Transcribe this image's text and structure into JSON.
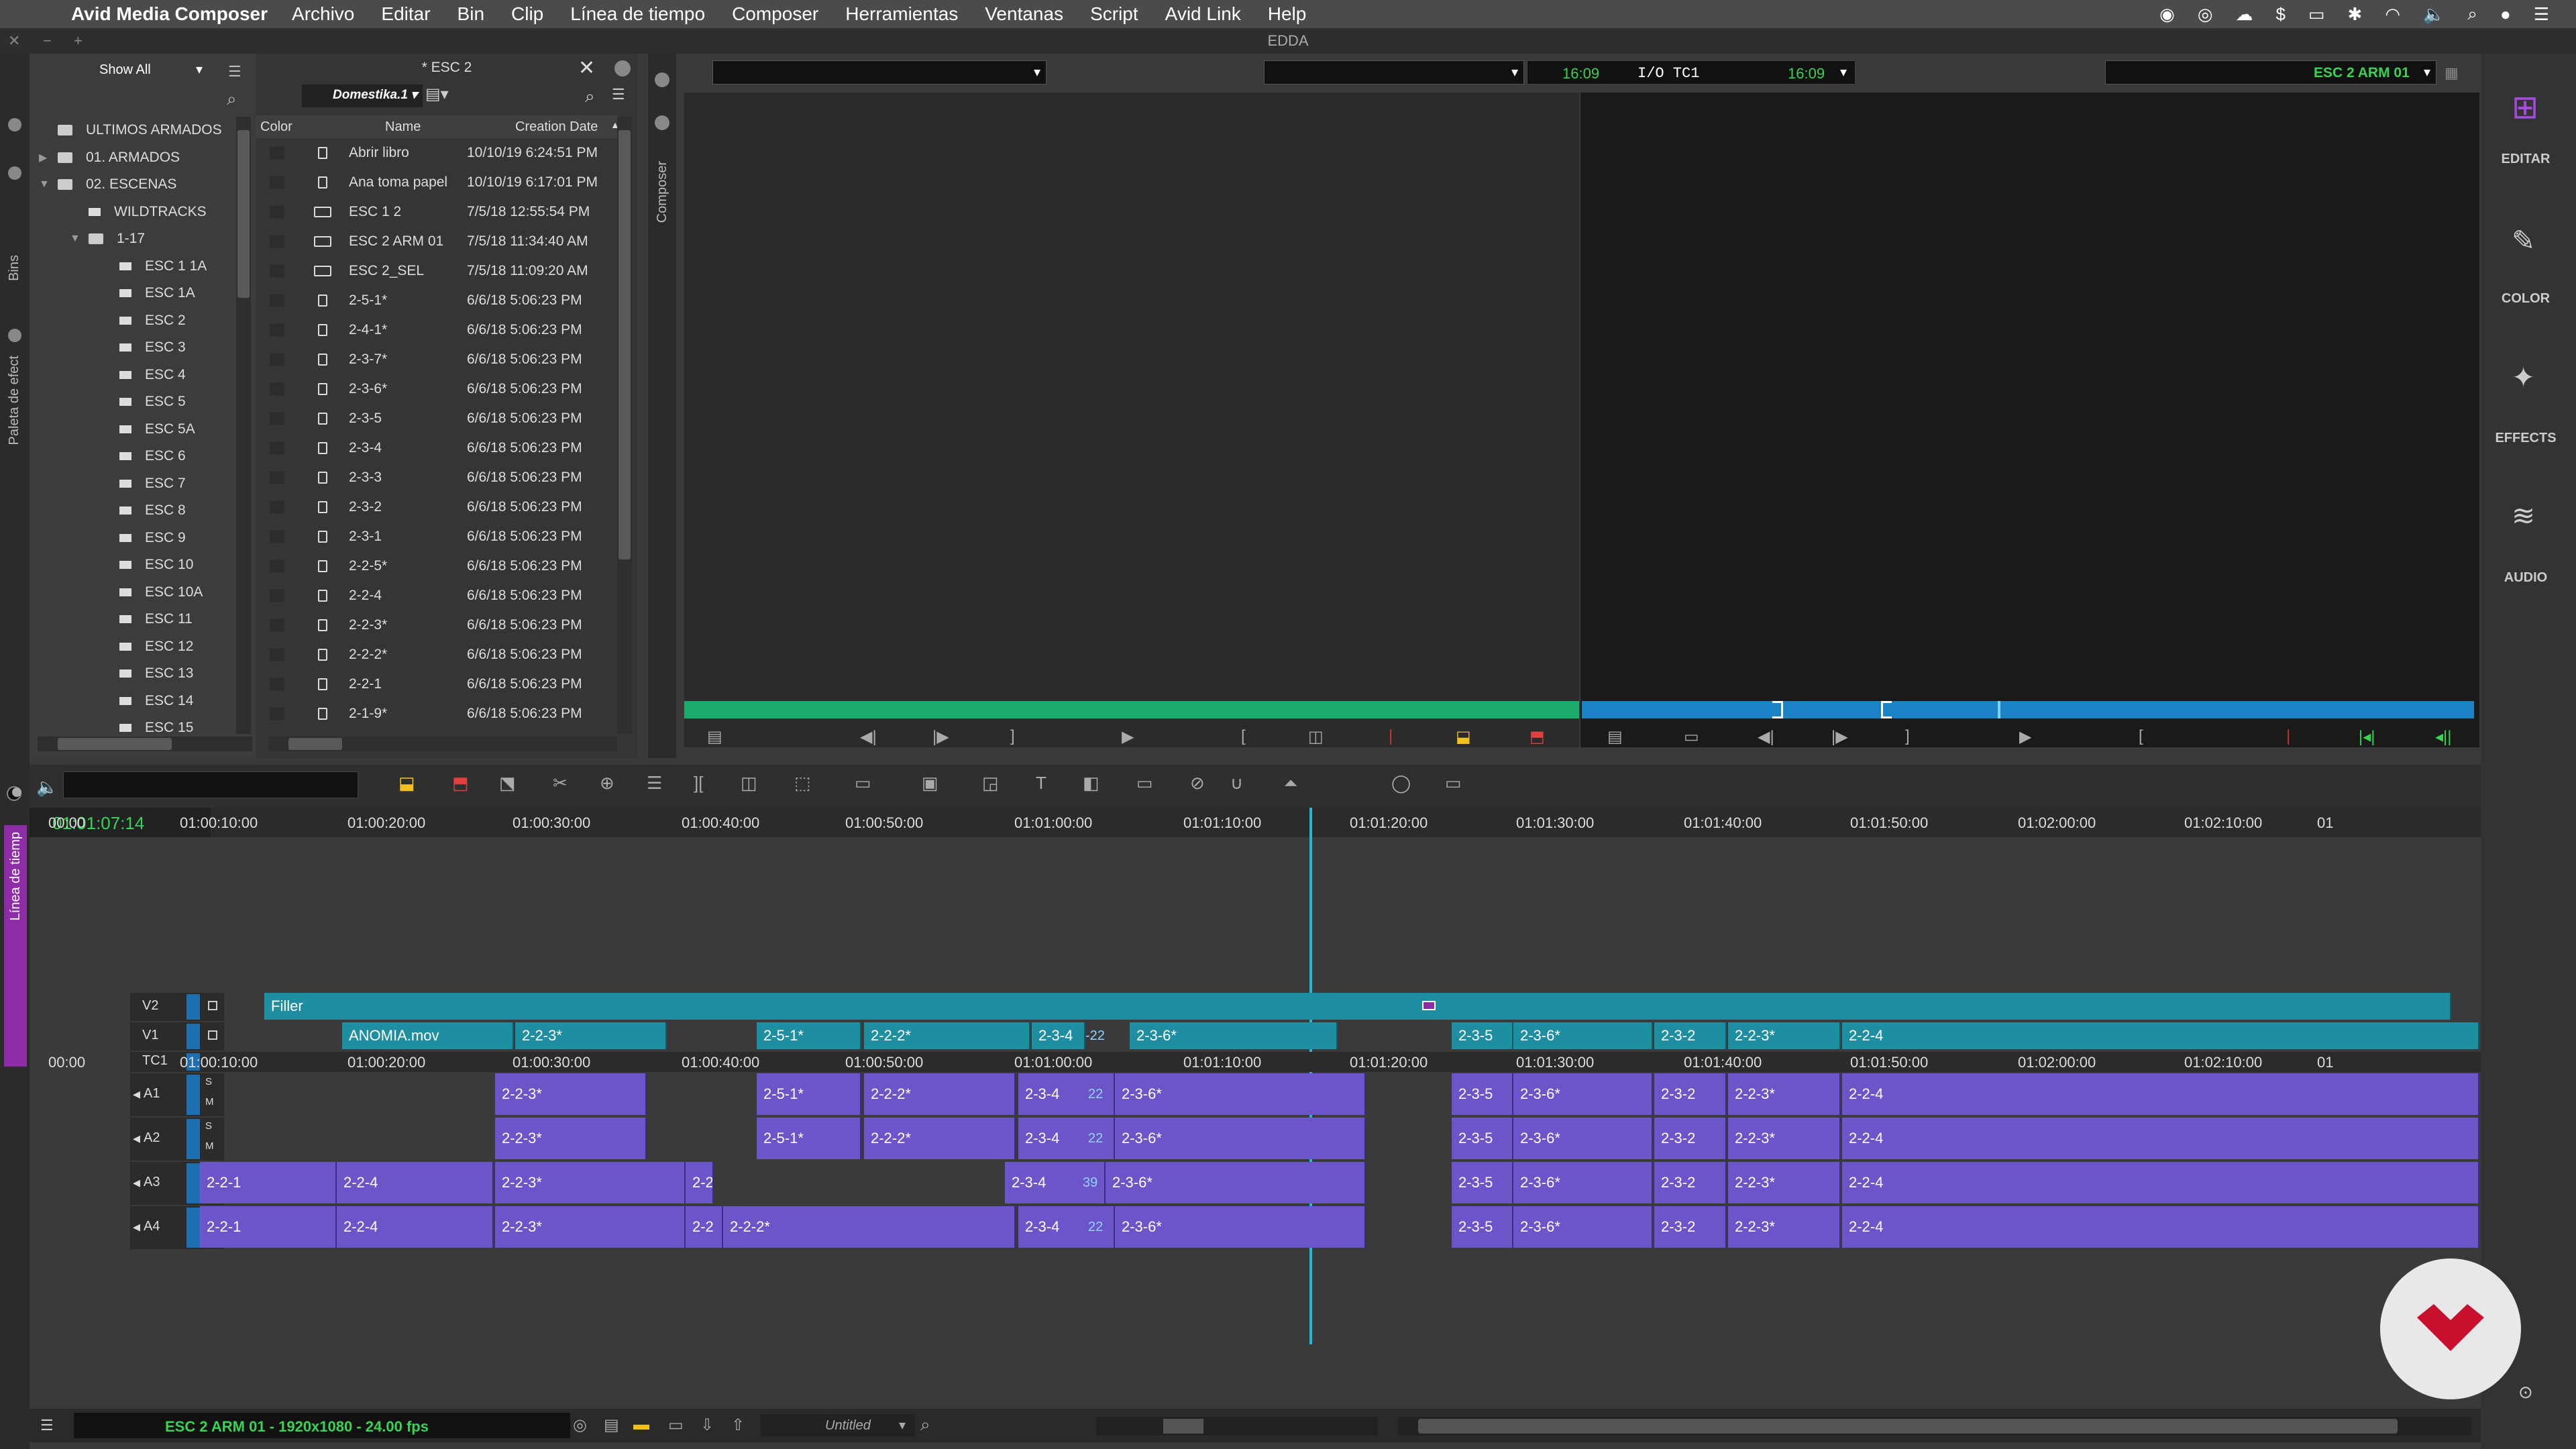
{
  "menubar": {
    "app_name": "Avid Media Composer",
    "items": [
      "Archivo",
      "Editar",
      "Bin",
      "Clip",
      "Línea de tiempo",
      "Composer",
      "Herramientas",
      "Ventanas",
      "Script",
      "Avid Link",
      "Help"
    ]
  },
  "window_title": "EDDA",
  "side_tabs": {
    "bins": "Bins",
    "effects": "Paleta de efect",
    "timeline": "Línea de tiemp",
    "composer": "Composer"
  },
  "tree": {
    "show_all": "Show All",
    "items": [
      {
        "label": "ULTIMOS ARMADOS",
        "indent": 0,
        "arrow": "",
        "folder": true
      },
      {
        "label": "01. ARMADOS",
        "indent": 0,
        "arrow": "▶",
        "folder": true
      },
      {
        "label": "02. ESCENAS",
        "indent": 0,
        "arrow": "▼",
        "folder": true
      },
      {
        "label": "WILDTRACKS",
        "indent": 1,
        "arrow": "",
        "folder": false
      },
      {
        "label": "1-17",
        "indent": 1,
        "arrow": "▼",
        "folder": true
      },
      {
        "label": "ESC 1 1A",
        "indent": 2,
        "arrow": "",
        "folder": false
      },
      {
        "label": "ESC 1A",
        "indent": 2,
        "arrow": "",
        "folder": false
      },
      {
        "label": "ESC 2",
        "indent": 2,
        "arrow": "",
        "folder": false
      },
      {
        "label": "ESC 3",
        "indent": 2,
        "arrow": "",
        "folder": false
      },
      {
        "label": "ESC 4",
        "indent": 2,
        "arrow": "",
        "folder": false
      },
      {
        "label": "ESC 5",
        "indent": 2,
        "arrow": "",
        "folder": false
      },
      {
        "label": "ESC 5A",
        "indent": 2,
        "arrow": "",
        "folder": false
      },
      {
        "label": "ESC 6",
        "indent": 2,
        "arrow": "",
        "folder": false
      },
      {
        "label": "ESC 7",
        "indent": 2,
        "arrow": "",
        "folder": false
      },
      {
        "label": "ESC 8",
        "indent": 2,
        "arrow": "",
        "folder": false
      },
      {
        "label": "ESC 9",
        "indent": 2,
        "arrow": "",
        "folder": false
      },
      {
        "label": "ESC 10",
        "indent": 2,
        "arrow": "",
        "folder": false
      },
      {
        "label": "ESC 10A",
        "indent": 2,
        "arrow": "",
        "folder": false
      },
      {
        "label": "ESC 11",
        "indent": 2,
        "arrow": "",
        "folder": false
      },
      {
        "label": "ESC 12",
        "indent": 2,
        "arrow": "",
        "folder": false
      },
      {
        "label": "ESC 13",
        "indent": 2,
        "arrow": "",
        "folder": false
      },
      {
        "label": "ESC 14",
        "indent": 2,
        "arrow": "",
        "folder": false
      },
      {
        "label": "ESC 15",
        "indent": 2,
        "arrow": "",
        "folder": false
      }
    ]
  },
  "bin": {
    "title": "* ESC 2",
    "view_name": "Domestika.1",
    "columns": [
      "Color",
      "Name",
      "Creation Date"
    ],
    "rows": [
      {
        "name": "Abrir libro",
        "date": "10/10/19 6:24:51 PM",
        "type": "clip"
      },
      {
        "name": "Ana toma papel",
        "date": "10/10/19 6:17:01 PM",
        "type": "clip"
      },
      {
        "name": "ESC 1 2",
        "date": "7/5/18 12:55:54 PM",
        "type": "seq"
      },
      {
        "name": "ESC 2 ARM 01",
        "date": "7/5/18 11:34:40 AM",
        "type": "seq"
      },
      {
        "name": "ESC 2_SEL",
        "date": "7/5/18 11:09:20 AM",
        "type": "seq"
      },
      {
        "name": "2-5-1*",
        "date": "6/6/18 5:06:23 PM",
        "type": "clip"
      },
      {
        "name": "2-4-1*",
        "date": "6/6/18 5:06:23 PM",
        "type": "clip"
      },
      {
        "name": "2-3-7*",
        "date": "6/6/18 5:06:23 PM",
        "type": "clip"
      },
      {
        "name": "2-3-6*",
        "date": "6/6/18 5:06:23 PM",
        "type": "clip"
      },
      {
        "name": "2-3-5",
        "date": "6/6/18 5:06:23 PM",
        "type": "clip"
      },
      {
        "name": "2-3-4",
        "date": "6/6/18 5:06:23 PM",
        "type": "clip"
      },
      {
        "name": "2-3-3",
        "date": "6/6/18 5:06:23 PM",
        "type": "clip"
      },
      {
        "name": "2-3-2",
        "date": "6/6/18 5:06:23 PM",
        "type": "clip"
      },
      {
        "name": "2-3-1",
        "date": "6/6/18 5:06:23 PM",
        "type": "clip"
      },
      {
        "name": "2-2-5*",
        "date": "6/6/18 5:06:23 PM",
        "type": "clip"
      },
      {
        "name": "2-2-4",
        "date": "6/6/18 5:06:23 PM",
        "type": "clip"
      },
      {
        "name": "2-2-3*",
        "date": "6/6/18 5:06:23 PM",
        "type": "clip"
      },
      {
        "name": "2-2-2*",
        "date": "6/6/18 5:06:23 PM",
        "type": "clip"
      },
      {
        "name": "2-2-1",
        "date": "6/6/18 5:06:23 PM",
        "type": "clip"
      },
      {
        "name": "2-1-9*",
        "date": "6/6/18 5:06:23 PM",
        "type": "clip"
      }
    ]
  },
  "composer": {
    "record_tc1": "16:09",
    "io_label": "I/O TC1",
    "record_tc2": "16:09",
    "sequence_name": "ESC 2 ARM 01"
  },
  "right_toolbar": [
    "EDITAR",
    "COLOR",
    "EFFECTS",
    "AUDIO"
  ],
  "timeline": {
    "timecode": "01:01:07:14",
    "ruler": [
      "00:00",
      "01:00:10:00",
      "01:00:20:00",
      "01:00:30:00",
      "01:00:40:00",
      "01:00:50:00",
      "01:01:00:00",
      "01:01:10:00",
      "01:01:20:00",
      "01:01:30:00",
      "01:01:40:00",
      "01:01:50:00",
      "01:02:00:00",
      "01:02:10:00",
      "01"
    ],
    "tc1_ruler": [
      "00:00",
      "01:00:10:00",
      "01:00:20:00",
      "01:00:30:00",
      "01:00:40:00",
      "01:00:50:00",
      "01:01:00:00",
      "01:01:10:00",
      "01:01:20:00",
      "01:01:30:00",
      "01:01:40:00",
      "01:01:50:00",
      "01:02:00:00",
      "01:02:10:00",
      "01"
    ],
    "tracks": [
      "V2",
      "V1",
      "TC1",
      "A1",
      "A2",
      "A3",
      "A4"
    ],
    "filler_label": "Filler",
    "v1_clips": [
      "ANOMIA.mov",
      "2-2-3*",
      "2-5-1*",
      "2-2-2*",
      "2-3-4",
      "-22",
      "2-3-6*",
      "2-3-5",
      "2-3-6*",
      "2-3-2",
      "2-2-3*",
      "2-2-4"
    ],
    "a1_clips": [
      "2-2-3*",
      "2-5-1*",
      "2-2-2*",
      "2-3-4",
      "22",
      "2-3-6*",
      "2-3-5",
      "2-3-6*",
      "2-3-2",
      "2-2-3*",
      "2-2-4"
    ],
    "a2_clips": [
      "2-2-3*",
      "2-5-1*",
      "2-2-2*",
      "2-3-4",
      "22",
      "2-3-6*",
      "2-3-5",
      "2-3-6*",
      "2-3-2",
      "2-2-3*",
      "2-2-4"
    ],
    "a3_clips": [
      "2-2-1",
      "2-2-4",
      "2-2-3*",
      "2-2",
      "2-3-4",
      "39",
      "2-3-6*",
      "2-3-5",
      "2-3-6*",
      "2-3-2",
      "2-2-3*",
      "2-2-4"
    ],
    "a4_clips": [
      "2-2-1",
      "2-2-4",
      "2-2-3*",
      "2-2",
      "2-2-2*",
      "2-3-4",
      "22",
      "2-3-6*",
      "2-3-5",
      "2-3-6*",
      "2-3-2",
      "2-2-3*",
      "2-2-4"
    ],
    "sm_labels": {
      "s": "S",
      "m": "M"
    },
    "status": "ESC 2 ARM 01 - 1920x1080 - 24.00 fps",
    "untitled": "Untitled"
  },
  "colors": {
    "video_clip": "#1e8fa0",
    "audio_clip": "#6b55c8",
    "playhead": "#25b5d8",
    "status_green": "#39d353",
    "accent_purple": "#9b30c8",
    "logo_red": "#c8102e"
  }
}
